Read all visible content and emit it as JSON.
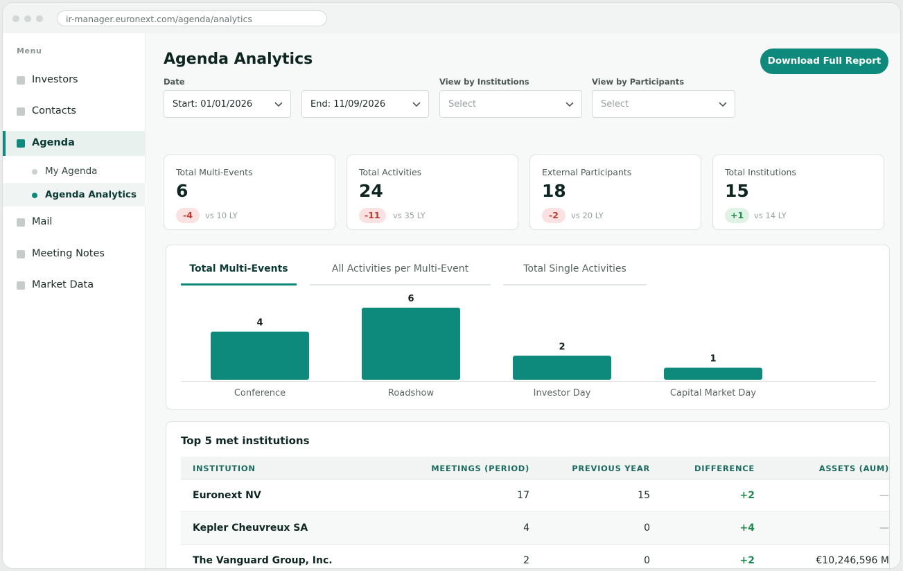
{
  "browser": {
    "url": "ir-manager.euronext.com/agenda/analytics"
  },
  "sidebar": {
    "menu_label": "Menu",
    "items": [
      {
        "label": "Investors"
      },
      {
        "label": "Contacts"
      },
      {
        "label": "Agenda",
        "active": true
      },
      {
        "label": "Mail"
      },
      {
        "label": "Meeting Notes"
      },
      {
        "label": "Market Data"
      }
    ],
    "sub_items": [
      {
        "label": "My Agenda"
      },
      {
        "label": "Agenda Analytics",
        "active": true
      }
    ]
  },
  "header": {
    "title": "Agenda Analytics",
    "download_label": "Download Full Report"
  },
  "filters": {
    "date_label": "Date",
    "start": "Start: 01/01/2026",
    "end": "End: 11/09/2026",
    "institutions_label": "View by Institutions",
    "institutions_placeholder": "Select",
    "participants_label": "View by Participants",
    "participants_placeholder": "Select"
  },
  "kpis": [
    {
      "label": "Total Multi-Events",
      "value": "6",
      "delta": "-4",
      "ly": "vs 10 LY",
      "trend": "neg"
    },
    {
      "label": "Total Activities",
      "value": "24",
      "delta": "-11",
      "ly": "vs 35 LY",
      "trend": "neg"
    },
    {
      "label": "External Participants",
      "value": "18",
      "delta": "-2",
      "ly": "vs 20 LY",
      "trend": "neg"
    },
    {
      "label": "Total Institutions",
      "value": "15",
      "delta": "+1",
      "ly": "vs 14 LY",
      "trend": "pos"
    }
  ],
  "tabs": [
    {
      "label": "Total Multi-Events",
      "active": true
    },
    {
      "label": "All Activities per Multi-Event"
    },
    {
      "label": "Total Single Activities"
    }
  ],
  "chart_data": {
    "type": "bar",
    "categories": [
      "Conference",
      "Roadshow",
      "Investor Day",
      "Capital Market Day"
    ],
    "values": [
      4,
      6,
      2,
      1
    ],
    "title": "",
    "xlabel": "",
    "ylabel": "",
    "ylim": [
      0,
      6
    ],
    "grid": false,
    "bar_color": "#0d8a7b"
  },
  "table": {
    "title": "Top 5 met institutions",
    "columns": [
      "INSTITUTION",
      "MEETINGS (PERIOD)",
      "PREVIOUS YEAR",
      "DIFFERENCE",
      "ASSETS (AUM)"
    ],
    "rows": [
      {
        "institution": "Euronext NV",
        "meetings": "17",
        "previous": "15",
        "difference": "+2",
        "aum": "—"
      },
      {
        "institution": "Kepler Cheuvreux SA",
        "meetings": "4",
        "previous": "0",
        "difference": "+4",
        "aum": "—"
      },
      {
        "institution": "The Vanguard Group, Inc.",
        "meetings": "2",
        "previous": "0",
        "difference": "+2",
        "aum": "€10,246,596 M"
      }
    ]
  },
  "colors": {
    "accent": "#0d8a7b",
    "negative": "#c0392b",
    "positive": "#1e8a4c"
  }
}
